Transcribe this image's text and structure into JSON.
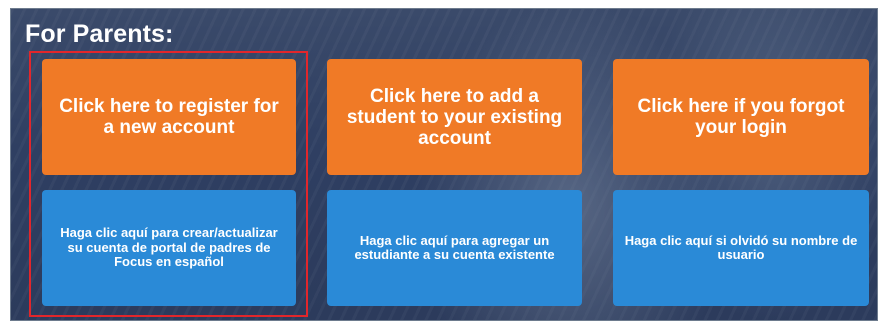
{
  "section": {
    "title": "For Parents:"
  },
  "buttons_english": [
    {
      "label": "Click here to register for a new account"
    },
    {
      "label": "Click here to add a student to your existing account"
    },
    {
      "label": "Click here if you forgot your login"
    }
  ],
  "buttons_spanish": [
    {
      "label": "Haga clic aquí para crear/actualizar su cuenta de portal de padres de Focus en español"
    },
    {
      "label": "Haga clic aquí para agregar un estudiante a su cuenta existente"
    },
    {
      "label": "Haga clic aquí si olvidó su nombre de usuario"
    }
  ],
  "colors": {
    "orange_button": "#f07a26",
    "blue_button": "#2a8ad7",
    "highlight_border": "#e2262b",
    "background": "#2f3f62"
  }
}
